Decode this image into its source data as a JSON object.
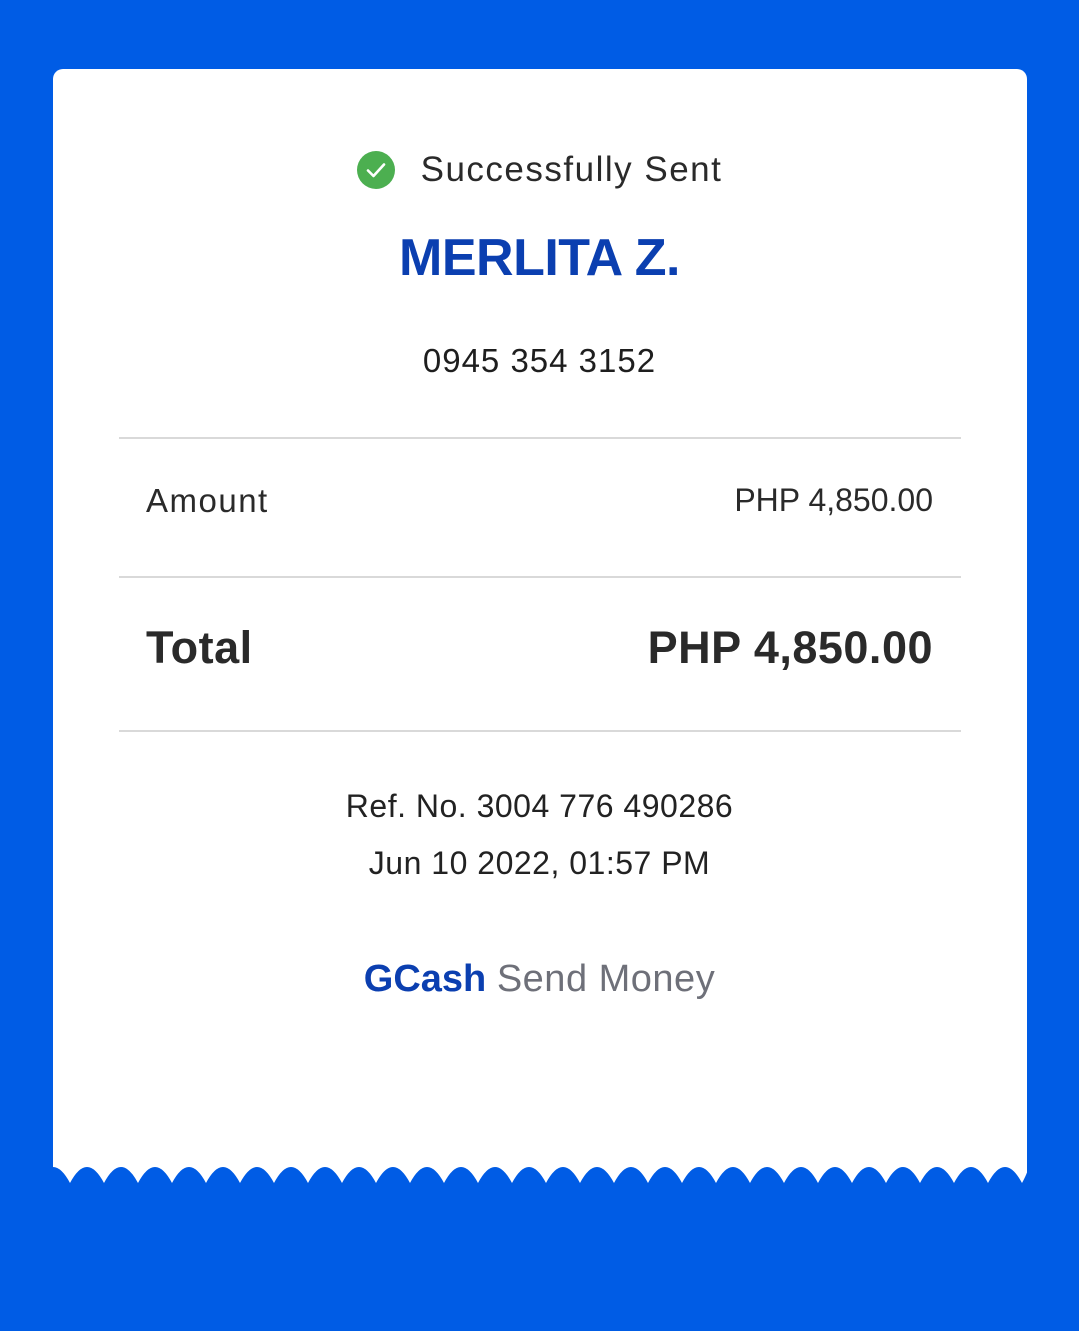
{
  "receipt": {
    "status": {
      "icon": "check-circle-icon",
      "text": "Successfully Sent",
      "color": "#4caf50"
    },
    "recipient": {
      "name": "MERLITA Z.",
      "phone": "0945 354 3152"
    },
    "amount": {
      "label": "Amount",
      "value": "PHP 4,850.00"
    },
    "total": {
      "label": "Total",
      "value": "PHP 4,850.00"
    },
    "reference": "Ref. No. 3004 776 490286",
    "datetime": "Jun 10 2022, 01:57 PM",
    "footer": {
      "brand": "GCash",
      "service": "Send Money"
    }
  },
  "colors": {
    "background": "#005ce5",
    "brand": "#0b3fb0",
    "success": "#4caf50"
  }
}
